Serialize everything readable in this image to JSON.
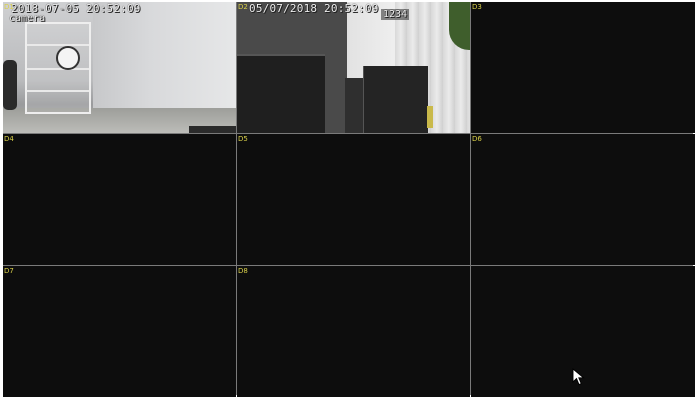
{
  "channels": [
    {
      "label": "D1",
      "osd_time": "2018-07-05 20:52:09",
      "osd_name": "camera",
      "active": true
    },
    {
      "label": "D2",
      "osd_time": "05/07/2018 20:52:09",
      "osd_name": "1234",
      "active": true
    },
    {
      "label": "D3",
      "active": false
    },
    {
      "label": "D4",
      "active": false
    },
    {
      "label": "D5",
      "active": false
    },
    {
      "label": "D6",
      "active": false
    },
    {
      "label": "D7",
      "active": false
    },
    {
      "label": "D8",
      "active": false
    },
    {
      "label": "",
      "active": false
    }
  ],
  "colors": {
    "background": "#0d0d0d",
    "grid_lines": "#7a7a7a",
    "channel_label": "#d9d04a",
    "osd_text": "#f0f0f0"
  },
  "icons": {
    "cursor": "mouse-pointer-icon"
  }
}
